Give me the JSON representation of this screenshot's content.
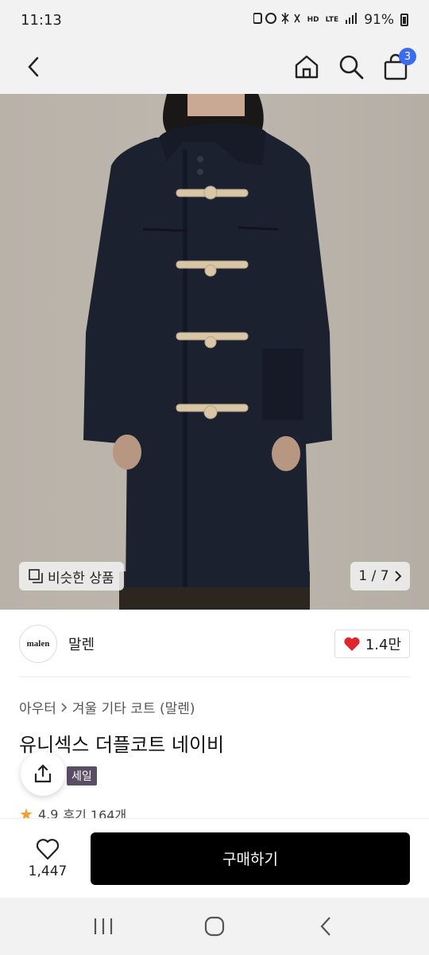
{
  "status_bar": {
    "time": "11:13",
    "network_hd": "HD",
    "network_lte": "LTE",
    "battery": "91%"
  },
  "header": {
    "back_icon": "chevron-left-icon",
    "home_icon": "home-icon",
    "search_icon": "search-icon",
    "cart_icon": "shopping-bag-icon",
    "cart_count": "3"
  },
  "product_image": {
    "similar_label": "비슷한 상품",
    "page_indicator": "1 / 7"
  },
  "brand": {
    "logo_text": "malen",
    "name": "말렌",
    "likes": "1.4만"
  },
  "breadcrumb": {
    "category": "아우터",
    "subcategory": "겨울 기타 코트 (말렌)"
  },
  "product": {
    "title": "유니섹스 더플코트 네이비",
    "sale_tag": "세일",
    "rating": "4.9",
    "reviews": "후기 164개"
  },
  "action_bar": {
    "wish_count": "1,447",
    "buy_label": "구매하기"
  },
  "colors": {
    "cart_badge": "#3b6bf0",
    "buy_button": "#000000",
    "heart": "#e0252b",
    "sale_tag": "#5b4d63"
  }
}
